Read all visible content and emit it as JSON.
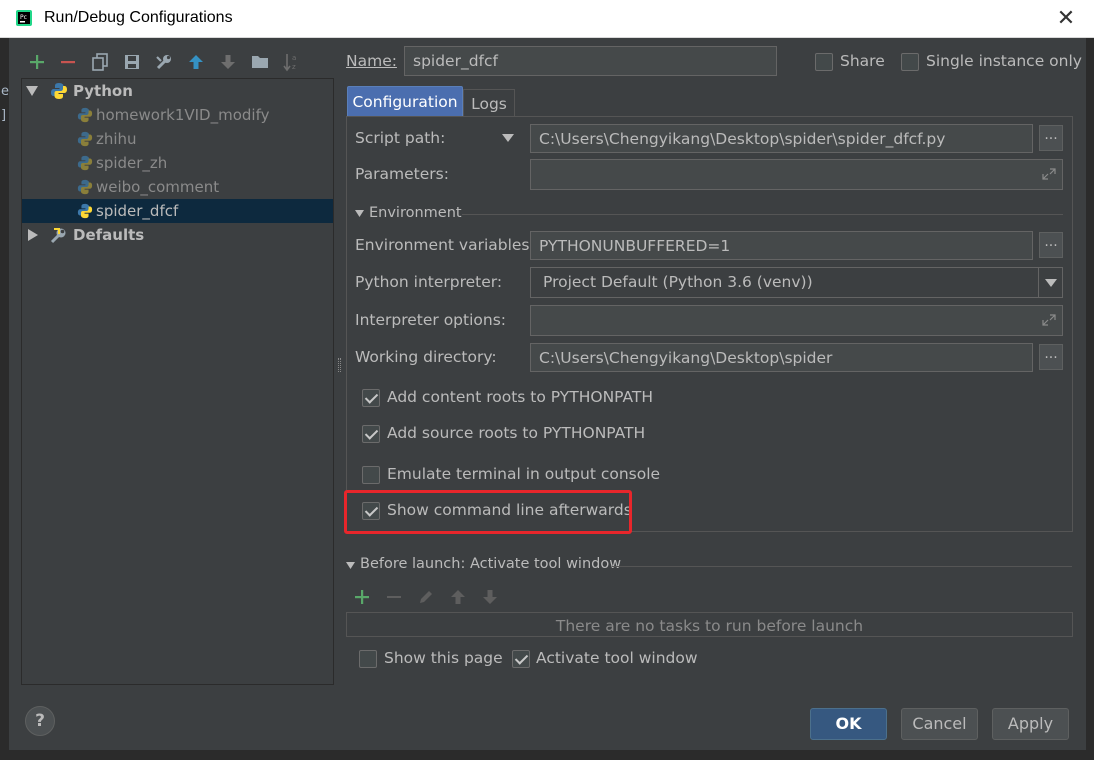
{
  "window": {
    "title": "Run/Debug Configurations"
  },
  "background_edge": {
    "line1": "e",
    "line2": "]"
  },
  "toolbar": {
    "icons": [
      "add-icon",
      "remove-icon",
      "copy-icon",
      "save-icon",
      "wrench-icon",
      "move-up-icon",
      "move-down-icon",
      "folder-icon",
      "sort-az-icon"
    ]
  },
  "tree": {
    "python": {
      "label": "Python"
    },
    "children": [
      {
        "label": "homework1VID_modify"
      },
      {
        "label": "zhihu"
      },
      {
        "label": "spider_zh"
      },
      {
        "label": "weibo_comment"
      },
      {
        "label": "spider_dfcf"
      }
    ],
    "defaults": {
      "label": "Defaults"
    }
  },
  "name_row": {
    "label": "Name:",
    "value": "spider_dfcf",
    "share": "Share",
    "single": "Single instance only"
  },
  "tabs": {
    "configuration": "Configuration",
    "logs": "Logs"
  },
  "form": {
    "script_path": {
      "label": "Script path:",
      "value": "C:\\Users\\Chengyikang\\Desktop\\spider\\spider_dfcf.py"
    },
    "parameters": {
      "label": "Parameters:",
      "value": ""
    },
    "environment_header": "Environment",
    "env_vars": {
      "label": "Environment variables:",
      "value": "PYTHONUNBUFFERED=1"
    },
    "interpreter": {
      "label": "Python interpreter:",
      "value": "Project Default (Python 3.6 (venv))"
    },
    "interp_options": {
      "label": "Interpreter options:",
      "value": ""
    },
    "working_dir": {
      "label": "Working directory:",
      "value": "C:\\Users\\Chengyikang\\Desktop\\spider"
    },
    "dots": "...",
    "checks": {
      "content_roots": "Add content roots to PYTHONPATH",
      "source_roots": "Add source roots to PYTHONPATH",
      "emulate_terminal": "Emulate terminal in output console",
      "show_cmd": "Show command line afterwards"
    }
  },
  "before_launch": {
    "header": "Before launch: Activate tool window",
    "empty_text": "There are no tasks to run before launch",
    "show_page": "Show this page",
    "activate_tool": "Activate tool window"
  },
  "buttons": {
    "ok": "OK",
    "cancel": "Cancel",
    "apply": "Apply",
    "help": "?"
  },
  "colors": {
    "highlight": "#e8262b",
    "accent_blue": "#365880",
    "selection": "#0d293e",
    "add_green": "#59a869"
  }
}
